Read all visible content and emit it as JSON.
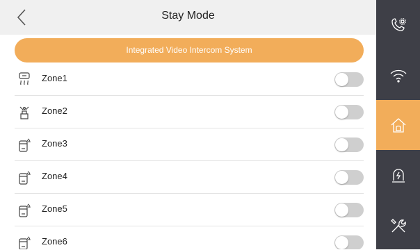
{
  "header": {
    "title": "Stay Mode"
  },
  "banner": {
    "text": "Integrated Video Intercom System"
  },
  "zones": [
    {
      "label": "Zone1",
      "icon": "smoke-detector-icon",
      "enabled": false
    },
    {
      "label": "Zone2",
      "icon": "gas-detector-icon",
      "enabled": false
    },
    {
      "label": "Zone3",
      "icon": "door-contact-icon",
      "enabled": false
    },
    {
      "label": "Zone4",
      "icon": "door-contact-icon",
      "enabled": false
    },
    {
      "label": "Zone5",
      "icon": "door-contact-icon",
      "enabled": false
    },
    {
      "label": "Zone6",
      "icon": "door-contact-icon",
      "enabled": false
    }
  ],
  "sidebar": [
    {
      "name": "call-settings",
      "icon": "phone-gear-icon",
      "active": false
    },
    {
      "name": "network",
      "icon": "wifi-icon",
      "active": false
    },
    {
      "name": "arming-mode",
      "icon": "home-alarm-icon",
      "active": true
    },
    {
      "name": "alarm",
      "icon": "siren-icon",
      "active": false
    },
    {
      "name": "tools",
      "icon": "tools-icon",
      "active": false
    }
  ],
  "colors": {
    "accent": "#f2ad5a",
    "sidebar_bg": "#3e3f47",
    "header_bg": "#f0f0f0",
    "toggle_off": "#cfcfcf"
  }
}
